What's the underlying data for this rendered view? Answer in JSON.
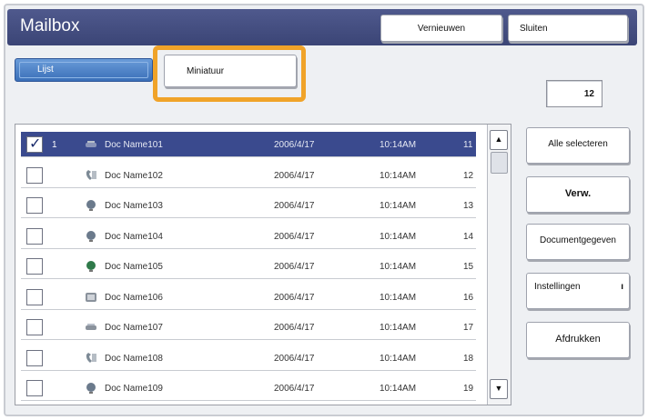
{
  "window": {
    "title": "Mailbox"
  },
  "header": {
    "refresh_label": "Vernieuwen",
    "exit_label": "Sluiten"
  },
  "tabs": {
    "list_label": "Lijst",
    "thumbnail_label": "Miniatuur"
  },
  "count": "12",
  "rows": [
    {
      "selected": true,
      "index": "1",
      "name": "Doc Name101",
      "date": "2006/4/17",
      "time": "10:14AM",
      "num": "11",
      "icon": "scanner-icon",
      "color": "#8a94b8"
    },
    {
      "selected": false,
      "index": "",
      "name": "Doc Name102",
      "date": "2006/4/17",
      "time": "10:14AM",
      "num": "12",
      "icon": "phone-icon",
      "color": "#7d8a96"
    },
    {
      "selected": false,
      "index": "",
      "name": "Doc Name103",
      "date": "2006/4/17",
      "time": "10:14AM",
      "num": "13",
      "icon": "globe-icon",
      "color": "#6b7a8c"
    },
    {
      "selected": false,
      "index": "",
      "name": "Doc Name104",
      "date": "2006/4/17",
      "time": "10:14AM",
      "num": "14",
      "icon": "globe-icon",
      "color": "#6b7a8c"
    },
    {
      "selected": false,
      "index": "",
      "name": "Doc Name105",
      "date": "2006/4/17",
      "time": "10:14AM",
      "num": "15",
      "icon": "globe-icon",
      "color": "#2f7a4a"
    },
    {
      "selected": false,
      "index": "",
      "name": "Doc Name106",
      "date": "2006/4/17",
      "time": "10:14AM",
      "num": "16",
      "icon": "document-icon",
      "color": "#8a929c"
    },
    {
      "selected": false,
      "index": "",
      "name": "Doc Name107",
      "date": "2006/4/17",
      "time": "10:14AM",
      "num": "17",
      "icon": "scanner-icon",
      "color": "#8a929c"
    },
    {
      "selected": false,
      "index": "",
      "name": "Doc Name108",
      "date": "2006/4/17",
      "time": "10:14AM",
      "num": "18",
      "icon": "phone-icon",
      "color": "#7d8a96"
    },
    {
      "selected": false,
      "index": "",
      "name": "Doc Name109",
      "date": "2006/4/17",
      "time": "10:14AM",
      "num": "19",
      "icon": "globe-icon",
      "color": "#6b7a8c"
    }
  ],
  "side_buttons": {
    "select_all": "Alle selecteren",
    "delete": "Verw.",
    "doc_info": "Documentgegeven",
    "settings": "Instellingen",
    "print": "Afdrukken"
  },
  "colors": {
    "header": "#3b4576",
    "selected_row": "#3a4a8e",
    "highlight": "#f0a329",
    "tab_active": "#3a6fb8"
  }
}
